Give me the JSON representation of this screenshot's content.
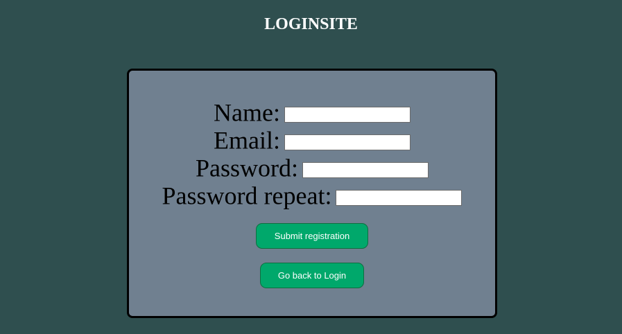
{
  "header": {
    "title": "LOGINSITE"
  },
  "form": {
    "fields": [
      {
        "label": "Name:",
        "value": "",
        "placeholder": ""
      },
      {
        "label": "Email:",
        "value": "",
        "placeholder": ""
      },
      {
        "label": "Password:",
        "value": "",
        "placeholder": ""
      },
      {
        "label": "Password repeat:",
        "value": "",
        "placeholder": ""
      }
    ],
    "submit_label": "Submit registration",
    "back_label": "Go back to Login"
  },
  "colors": {
    "page_background": "#2f4f4f",
    "card_background": "#708090",
    "button_background": "#00a86b",
    "title_text": "#ffffff"
  }
}
